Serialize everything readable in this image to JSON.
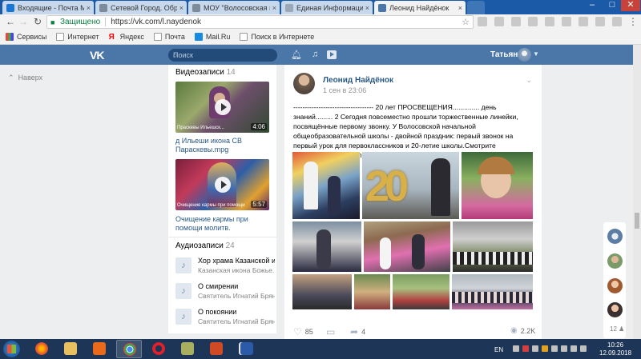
{
  "browser": {
    "tabs": [
      {
        "label": "Входящие - Почта Mail.R",
        "active": false
      },
      {
        "label": "Сетевой Город. Образо",
        "active": false
      },
      {
        "label": "МОУ \"Волосовская нача",
        "active": false
      },
      {
        "label": "Единая Информационн",
        "active": false
      },
      {
        "label": "Леонид Найдёнок",
        "active": true
      }
    ],
    "close_glyph": "×",
    "secure_label": "Защищено",
    "url": "https://vk.com/l.naydenok",
    "bookmarks": [
      "Сервисы",
      "Интернет",
      "Яндекс",
      "Почта",
      "Mail.Ru",
      "Поиск в Интернете"
    ],
    "win_min": "–",
    "win_max": "□",
    "win_close": "✕"
  },
  "vk": {
    "logo": "VK",
    "search_placeholder": "Поиск",
    "user_name": "Татьяна",
    "back_label": "Наверх",
    "colors": {
      "header": "#4a76a8",
      "link": "#2a5885",
      "background": "#edeef0"
    }
  },
  "videos": {
    "section_title": "Видеозаписи",
    "count": "14",
    "items": [
      {
        "title": "д Ильеши икона СВ Параскевы.mpg",
        "duration": "4:06",
        "caption": "Праскевы Ильешск..."
      },
      {
        "title": "Очищение кармы при помощи молитв.",
        "duration": "5:57",
        "caption": "Очищение кармы при помощи"
      }
    ]
  },
  "audios": {
    "section_title": "Аудиозаписи",
    "count": "24",
    "items": [
      {
        "title": "Хор храма Казанской ик...",
        "artist": "Казанская икона Божье..."
      },
      {
        "title": "О смирении",
        "artist": "Святитель Игнатий Брян..."
      },
      {
        "title": "О покоянии",
        "artist": "Святитель Игнатий Брян..."
      }
    ]
  },
  "post": {
    "author": "Леонид Найдёнок",
    "date": "1 сен в 23:06",
    "text": "----------------------------------- 20 лет ПРОСВЕЩЕНИЯ.............. день знаний......... 2 Сегодня повсеместно прошли торжественные линейки, посвящённые первому звонку. У Волосовской начальной общеобразовательной школы - двойной праздник: первый звонок на первый урок для первоклассников и 20-летие школы.Смотрите завершение фоторепортажа в этом фотоблоке.",
    "photo_overlay_text": "20",
    "likes": "85",
    "shares": "4",
    "views": "2.2K"
  },
  "right_rail": {
    "count": "12"
  },
  "taskbar": {
    "lang": "EN",
    "time": "10:26",
    "date": "12.09.2018"
  }
}
